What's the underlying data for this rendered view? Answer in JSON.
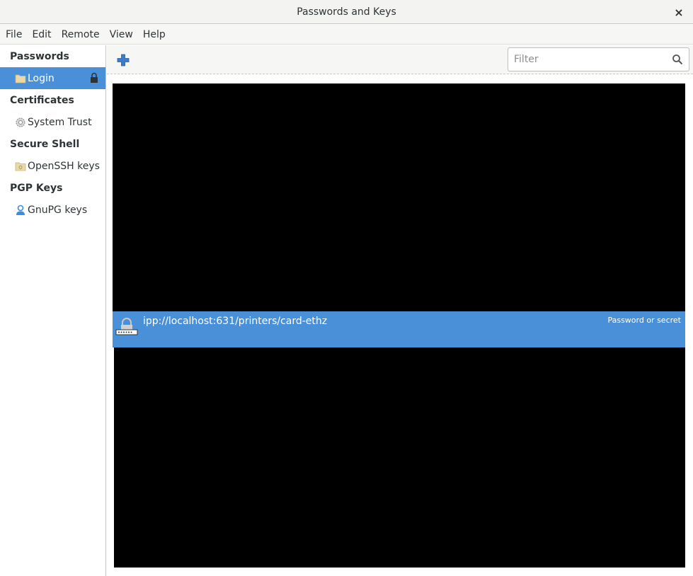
{
  "window": {
    "title": "Passwords and Keys",
    "close_label": "×"
  },
  "menubar": {
    "items": [
      "File",
      "Edit",
      "Remote",
      "View",
      "Help"
    ]
  },
  "sidebar": {
    "sections": [
      {
        "header": "Passwords",
        "items": [
          {
            "label": "Login",
            "icon": "folder-icon",
            "selected": true,
            "locked": true
          }
        ]
      },
      {
        "header": "Certificates",
        "items": [
          {
            "label": "System Trust",
            "icon": "gear-icon"
          }
        ]
      },
      {
        "header": "Secure Shell",
        "items": [
          {
            "label": "OpenSSH keys",
            "icon": "folder-icon"
          }
        ]
      },
      {
        "header": "PGP Keys",
        "items": [
          {
            "label": "GnuPG keys",
            "icon": "user-key-icon"
          }
        ]
      }
    ]
  },
  "toolbar": {
    "add_icon": "plus-icon",
    "filter_placeholder": "Filter",
    "filter_value": ""
  },
  "content": {
    "selected_item": {
      "title": "ipp://localhost:631/printers/card-ethz",
      "type": "Password or secret",
      "icon": "password-keyring-icon"
    }
  },
  "colors": {
    "accent": "#4a90d9",
    "redacted": "#000000"
  }
}
